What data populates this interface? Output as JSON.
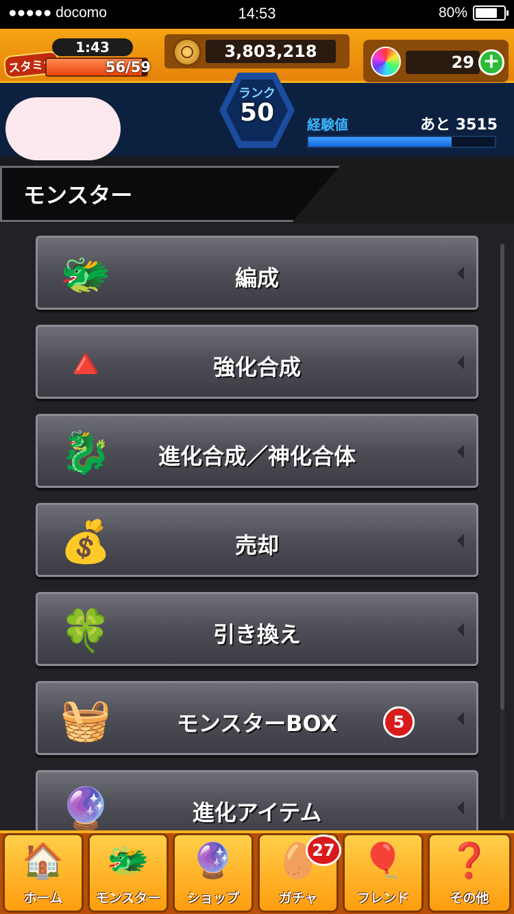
{
  "status_bar": {
    "carrier": "●●●●● docomo",
    "time": "14:53",
    "battery": "80%",
    "battery_level": 0.8
  },
  "hud": {
    "stamina_label": "スタミナ",
    "stamina_timer": "1:43",
    "stamina": "56/59",
    "stamina_level": 0.95,
    "gold": "3,803,218",
    "orbs": "29",
    "rank_label": "ランク",
    "rank": "50",
    "exp_label": "経験値",
    "exp_remaining": "あと 3515",
    "exp_level": 0.77
  },
  "section_title": "モンスター",
  "menu": [
    {
      "label": "編成",
      "icon": "team-monsters-icon"
    },
    {
      "label": "強化合成",
      "icon": "power-up-icon"
    },
    {
      "label": "進化合成／神化合体",
      "icon": "evolution-icon"
    },
    {
      "label": "売却",
      "icon": "money-bag-icon"
    },
    {
      "label": "引き換え",
      "icon": "clover-icon"
    },
    {
      "label": "モンスターBOX",
      "icon": "monster-box-icon",
      "badge": "5"
    },
    {
      "label": "進化アイテム",
      "icon": "evolution-orbs-icon"
    }
  ],
  "tabs": [
    {
      "label": "ホーム",
      "icon": "home-icon"
    },
    {
      "label": "モンスター",
      "icon": "monster-icon"
    },
    {
      "label": "ショップ",
      "icon": "orb-shop-icon"
    },
    {
      "label": "ガチャ",
      "icon": "egg-gacha-icon",
      "badge": "27"
    },
    {
      "label": "フレンド",
      "icon": "friend-balloons-icon"
    },
    {
      "label": "その他",
      "icon": "other-icon"
    }
  ],
  "colors": {
    "hud_orange": "#f6a412",
    "hud_navy": "#0c2140",
    "exp_blue": "#3cb4ff",
    "badge_red": "#d81b1b",
    "plus_green": "#2dbb3a"
  }
}
